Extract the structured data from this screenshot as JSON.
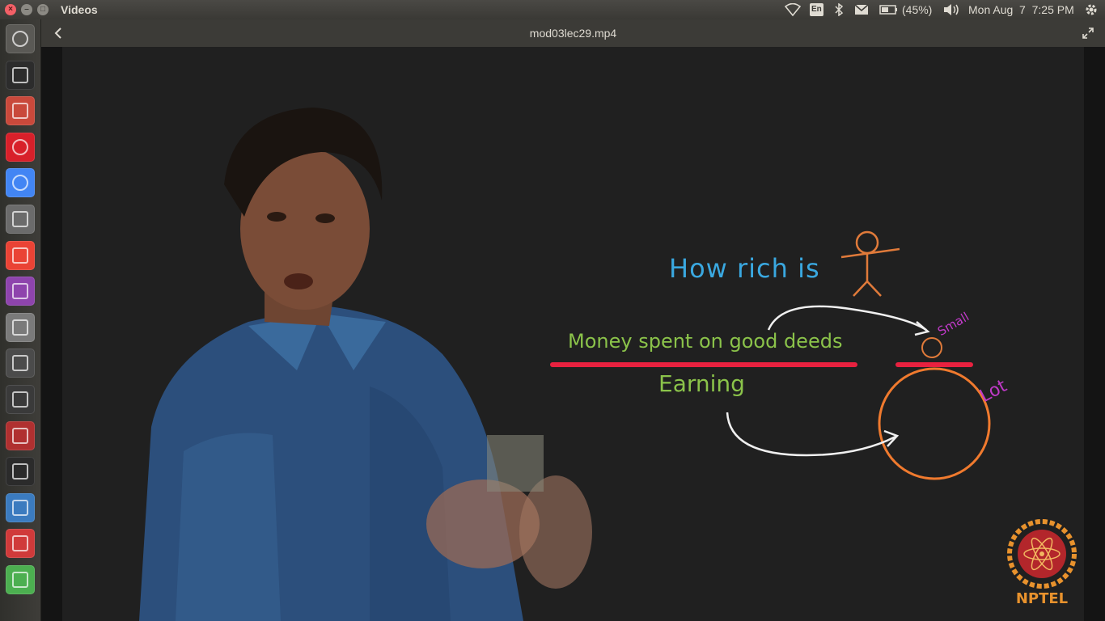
{
  "window": {
    "app_title": "Videos",
    "controls": [
      "close",
      "minimize",
      "maximize"
    ]
  },
  "tray": {
    "language": "En",
    "battery": "(45%)",
    "clock": "Mon Aug  7  7:25 PM",
    "icons": [
      "wifi-icon",
      "keyboard-layout-icon",
      "bluetooth-icon",
      "mail-icon",
      "battery-icon",
      "volume-icon",
      "gear-icon"
    ]
  },
  "launcher": {
    "items": [
      {
        "name": "dash-home",
        "color": "#5a5955"
      },
      {
        "name": "terminal",
        "color": "#2c2c2c"
      },
      {
        "name": "files",
        "color": "#c9493b"
      },
      {
        "name": "opera",
        "color": "#d8202a"
      },
      {
        "name": "chrome",
        "color": "#4285f4"
      },
      {
        "name": "video-editor",
        "color": "#6b6b6b"
      },
      {
        "name": "gmail",
        "color": "#ea4335"
      },
      {
        "name": "webcam",
        "color": "#8e44ad"
      },
      {
        "name": "text-editor",
        "color": "#7a7a7a"
      },
      {
        "name": "sublime-text",
        "color": "#4b4b4b"
      },
      {
        "name": "ipython",
        "color": "#3a3a3a"
      },
      {
        "name": "network-tool",
        "color": "#b03030"
      },
      {
        "name": "gp-tool",
        "color": "#2b2b2b"
      },
      {
        "name": "document-viewer",
        "color": "#3b7bbf"
      },
      {
        "name": "pdf-reader",
        "color": "#d03a3a"
      },
      {
        "name": "package-installer",
        "color": "#4caf50"
      }
    ]
  },
  "video": {
    "filename": "mod03lec29.mp4"
  },
  "board": {
    "question": "How rich is",
    "numerator": "Money spent on good deeds",
    "denominator": "Earning",
    "small_label": "Small",
    "lot_label": "Lot",
    "logo_text": "NPTEL"
  },
  "colors": {
    "question": "#3aa8e0",
    "numerator": "#8bc34a",
    "fraction_bar": "#e8213f",
    "stick_figure": "#e07a3a",
    "small_label": "#c03ac8",
    "circle": "#f07a2e",
    "arrows": "#f0f0f0",
    "logo": "#e8922d"
  }
}
